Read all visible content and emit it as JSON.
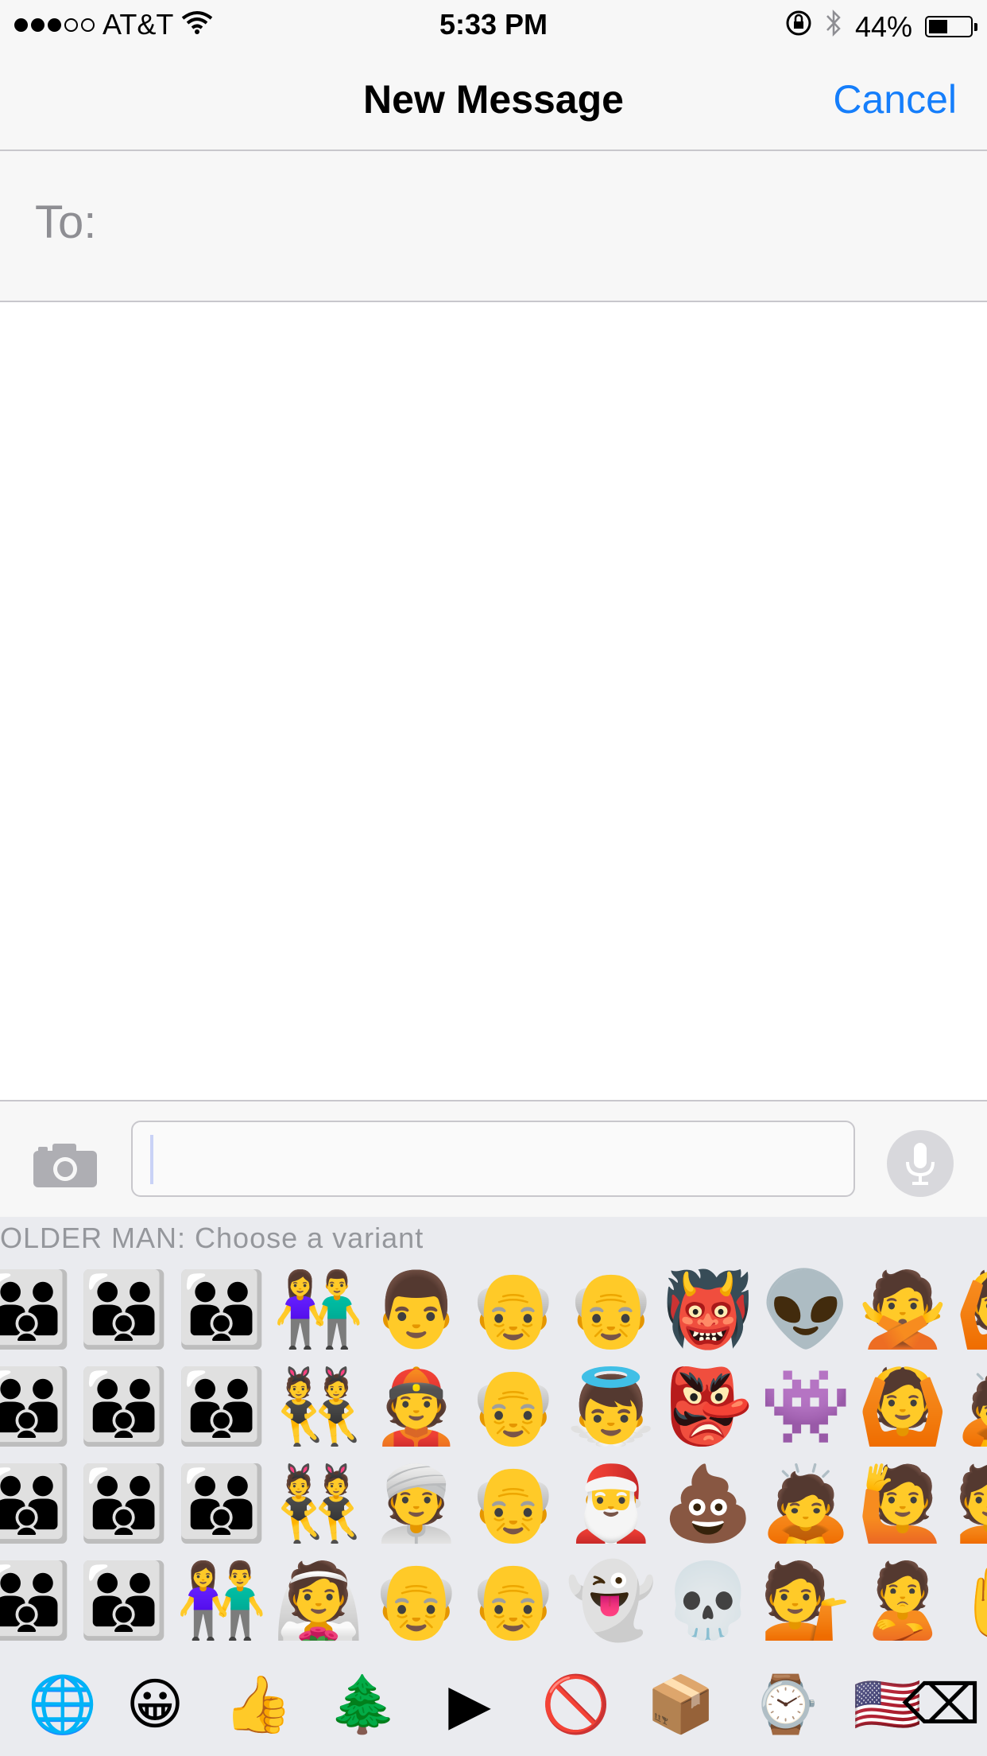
{
  "status_bar": {
    "signal": {
      "filled": 3,
      "empty": 2
    },
    "carrier": "AT&T",
    "time": "5:33 PM",
    "battery_percent": "44%",
    "battery_level": 0.44,
    "icons": [
      "wifi-icon",
      "orientation-lock-icon",
      "bluetooth-icon",
      "battery-icon"
    ]
  },
  "nav": {
    "title": "New Message",
    "cancel_label": "Cancel"
  },
  "to_field": {
    "label": "To:"
  },
  "composer": {
    "camera_icon": "camera-icon",
    "message_value": "",
    "mic_icon": "microphone-icon"
  },
  "keyboard": {
    "variant_hint": "OLDER MAN: Choose a variant",
    "emoji_rows": [
      [
        "👪",
        "👪",
        "👪",
        "👫",
        "👨",
        "👴",
        "👴",
        "👹",
        "👽",
        "🙅",
        "🙆"
      ],
      [
        "👪",
        "👪",
        "👪",
        "👯",
        "👲",
        "👴",
        "👼",
        "👺",
        "👾",
        "🙆",
        "🙇"
      ],
      [
        "👪",
        "👪",
        "👪",
        "👯",
        "👳",
        "👴",
        "🎅",
        "💩",
        "🙇",
        "🙋",
        "💁"
      ],
      [
        "👪",
        "👪",
        "👫",
        "👰",
        "👴",
        "👴",
        "👻",
        "💀",
        "💁",
        "🙎",
        "✋"
      ]
    ],
    "categories": [
      {
        "name": "globe-icon",
        "glyph": "🌐"
      },
      {
        "name": "smiley-category-icon",
        "glyph": "😀"
      },
      {
        "name": "thumbs-up-category-icon",
        "glyph": "👍"
      },
      {
        "name": "tree-category-icon",
        "glyph": "🌲"
      },
      {
        "name": "play-category-icon",
        "glyph": "▶"
      },
      {
        "name": "no-entry-category-icon",
        "glyph": "🚫"
      },
      {
        "name": "package-category-icon",
        "glyph": "📦"
      },
      {
        "name": "watch-category-icon",
        "glyph": "⌚"
      },
      {
        "name": "flag-category-icon",
        "glyph": "🇺🇸"
      },
      {
        "name": "backspace-icon",
        "glyph": "⌫"
      }
    ]
  },
  "colors": {
    "accent": "#157efb",
    "bar_background": "#f7f7f7",
    "keyboard_background": "#eaebef",
    "separator": "#c8c7cc"
  }
}
